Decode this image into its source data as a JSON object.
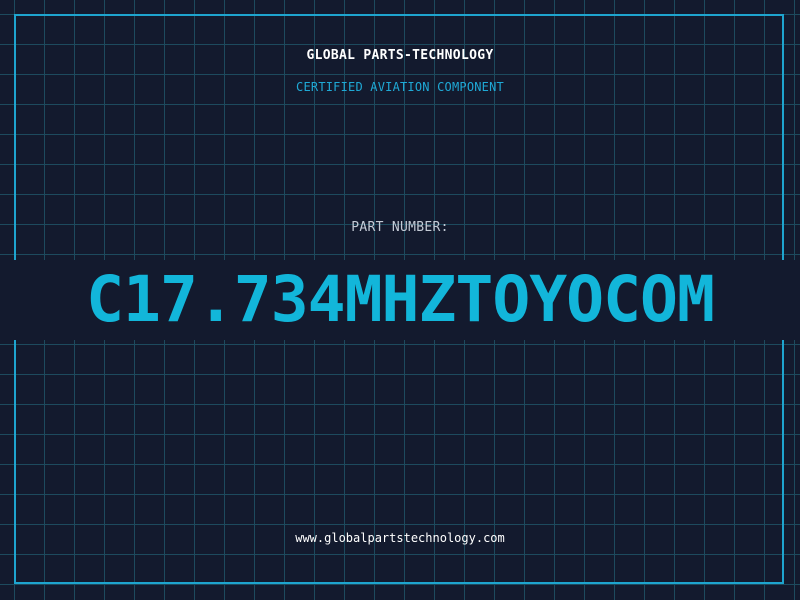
{
  "header": {
    "company": "GLOBAL PARTS-TECHNOLOGY",
    "subtitle": "CERTIFIED AVIATION COMPONENT"
  },
  "part": {
    "label": "PART NUMBER:",
    "number": "C17.734MHZTOYOCOM"
  },
  "footer": {
    "website": "www.globalpartstechnology.com"
  },
  "colors": {
    "background": "#131a2e",
    "grid": "#1d4a5e",
    "accent": "#12b6da",
    "frame": "#1ea4cf",
    "text": "#ffffff"
  }
}
